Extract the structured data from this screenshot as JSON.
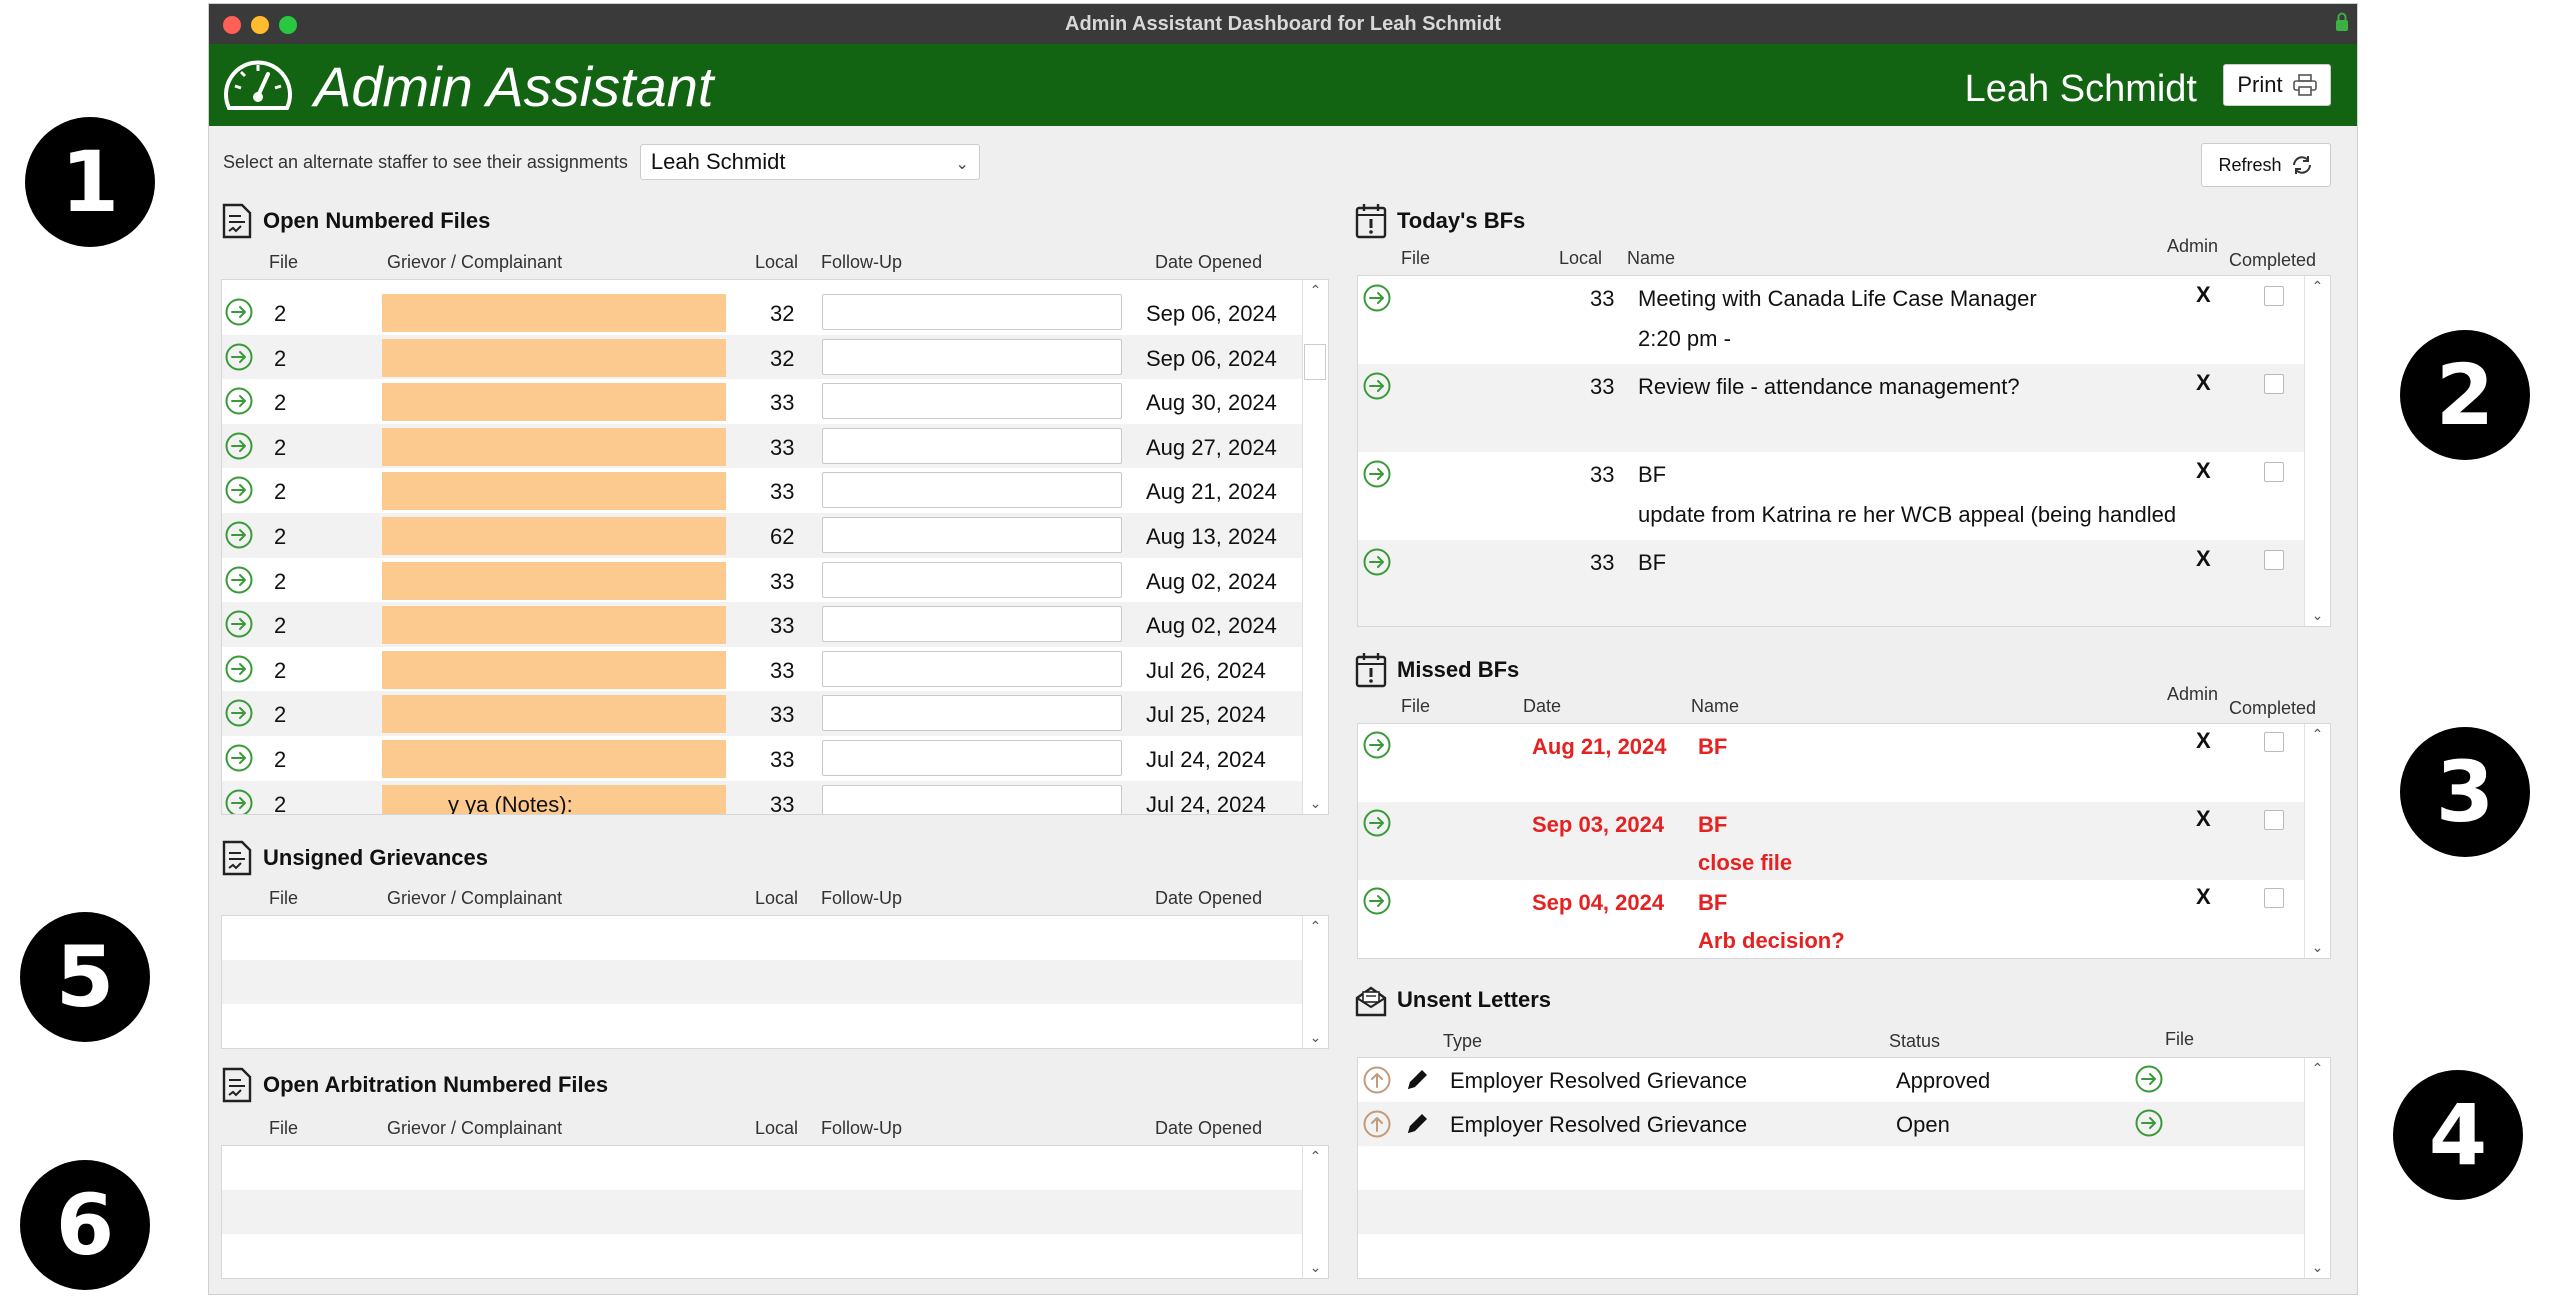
{
  "window": {
    "title": "Admin Assistant Dashboard for Leah Schmidt"
  },
  "colors": {
    "header_green": "#126312",
    "redact_orange": "#fcc98f",
    "missed_red": "#e52222",
    "arrow_green": "#3a9a3a"
  },
  "header": {
    "app_title": "Admin Assistant",
    "user_name": "Leah Schmidt",
    "print_label": "Print"
  },
  "staffer": {
    "prompt": "Select an alternate staffer to see their assignments",
    "selected": "Leah Schmidt"
  },
  "refresh_label": "Refresh",
  "callouts": [
    "1",
    "2",
    "3",
    "4",
    "5",
    "6"
  ],
  "open_files": {
    "title": "Open Numbered Files",
    "headers": {
      "file": "File",
      "grievor": "Grievor / Complainant",
      "local": "Local",
      "followup": "Follow-Up",
      "date": "Date Opened"
    },
    "rows": [
      {
        "file": "2",
        "grievor": "",
        "local": "32",
        "date": "Sep 06, 2024"
      },
      {
        "file": "2",
        "grievor": "",
        "local": "32",
        "date": "Sep 06, 2024"
      },
      {
        "file": "2",
        "grievor": "",
        "local": "33",
        "date": "Aug 30, 2024"
      },
      {
        "file": "2",
        "grievor": "",
        "local": "33",
        "date": "Aug 27, 2024"
      },
      {
        "file": "2",
        "grievor": "",
        "local": "33",
        "date": "Aug 21, 2024"
      },
      {
        "file": "2",
        "grievor": "",
        "local": "62",
        "date": "Aug 13, 2024"
      },
      {
        "file": "2",
        "grievor": "",
        "local": "33",
        "date": "Aug 02, 2024"
      },
      {
        "file": "2",
        "grievor": "",
        "local": "33",
        "date": "Aug 02, 2024"
      },
      {
        "file": "2",
        "grievor": "",
        "local": "33",
        "date": "Jul 26, 2024"
      },
      {
        "file": "2",
        "grievor": "",
        "local": "33",
        "date": "Jul 25, 2024"
      },
      {
        "file": "2",
        "grievor": "",
        "local": "33",
        "date": "Jul 24, 2024"
      },
      {
        "file": "2",
        "grievor": "y                    ya (Notes):",
        "local": "33",
        "date": "Jul 24, 2024"
      }
    ]
  },
  "unsigned": {
    "title": "Unsigned Grievances",
    "headers": {
      "file": "File",
      "grievor": "Grievor / Complainant",
      "local": "Local",
      "followup": "Follow-Up",
      "date": "Date Opened"
    }
  },
  "arbitration": {
    "title": "Open Arbitration Numbered Files",
    "headers": {
      "file": "File",
      "grievor": "Grievor / Complainant",
      "local": "Local",
      "followup": "Follow-Up",
      "date": "Date Opened"
    }
  },
  "todays_bfs": {
    "title": "Today's BFs",
    "headers": {
      "file": "File",
      "local": "Local",
      "name": "Name",
      "admin": "Admin",
      "completed": "Completed"
    },
    "rows": [
      {
        "local": "33",
        "name": "Meeting with Canada Life Case Manager",
        "detail": "2:20 pm -",
        "admin": "X"
      },
      {
        "local": "33",
        "name": "Review file - attendance management?",
        "detail": "",
        "admin": "X"
      },
      {
        "local": "33",
        "name": "BF",
        "detail": "update from Katrina re her WCB appeal (being handled",
        "admin": "X"
      },
      {
        "local": "33",
        "name": "BF",
        "detail": "",
        "admin": "X"
      }
    ]
  },
  "missed_bfs": {
    "title": "Missed BFs",
    "headers": {
      "file": "File",
      "date": "Date",
      "name": "Name",
      "admin": "Admin",
      "completed": "Completed"
    },
    "rows": [
      {
        "date": "Aug 21, 2024",
        "name": "BF",
        "detail": "",
        "admin": "X"
      },
      {
        "date": "Sep 03, 2024",
        "name": "BF",
        "detail": "close file",
        "admin": "X"
      },
      {
        "date": "Sep 04, 2024",
        "name": "BF",
        "detail": "Arb decision?",
        "admin": "X"
      }
    ]
  },
  "unsent_letters": {
    "title": "Unsent Letters",
    "headers": {
      "type": "Type",
      "status": "Status",
      "file": "File"
    },
    "rows": [
      {
        "type": "Employer Resolved Grievance",
        "status": "Approved"
      },
      {
        "type": "Employer Resolved Grievance",
        "status": "Open"
      }
    ]
  }
}
